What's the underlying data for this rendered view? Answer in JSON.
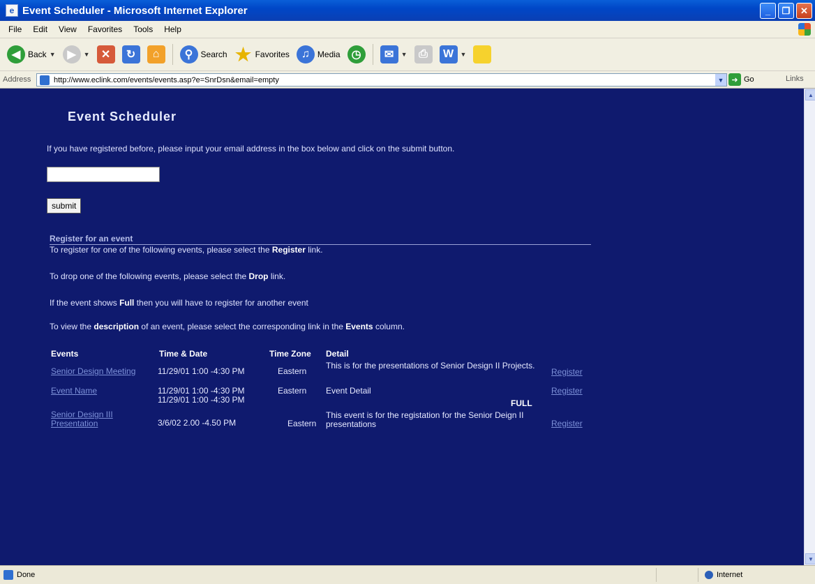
{
  "window": {
    "title": "Event Scheduler - Microsoft Internet Explorer"
  },
  "menu": [
    "File",
    "Edit",
    "View",
    "Favorites",
    "Tools",
    "Help"
  ],
  "toolbar": {
    "back": "Back",
    "search": "Search",
    "favorites": "Favorites",
    "media": "Media"
  },
  "address": {
    "label": "Address",
    "url": "http://www.eclink.com/events/events.asp?e=SnrDsn&email=empty",
    "go": "Go",
    "links": "Links"
  },
  "page": {
    "title": "Event Scheduler",
    "intro": "If you have registered before, please input your email address in the box below and click on the submit button.",
    "email_value": "",
    "submit_label": "submit",
    "section_heading": "Register for an event",
    "instr_register_pre": "To register for one of the following events, please select the ",
    "instr_register_bold": "Register",
    "instr_register_post": " link.",
    "instr_drop_pre": "To drop one of the following events, please select the ",
    "instr_drop_bold": "Drop",
    "instr_drop_post": " link.",
    "instr_full_pre": "If the event shows ",
    "instr_full_bold": "Full",
    "instr_full_post": " then you will have to register for another event",
    "instr_desc_pre": "To view the ",
    "instr_desc_bold": "description",
    "instr_desc_mid": " of an event, please select the corresponding link in the ",
    "instr_desc_bold2": "Events",
    "instr_desc_post": " column."
  },
  "table": {
    "headers": {
      "events": "Events",
      "time": "Time & Date",
      "zone": "Time Zone",
      "detail": "Detail"
    },
    "rows": [
      {
        "event": "Senior Design Meeting",
        "time": "11/29/01  1:00 -4:30 PM",
        "zone": "Eastern",
        "detail": "This is for the presentations of Senior Design II Projects.",
        "action": "Register"
      },
      {
        "event": "Event Name",
        "time": "11/29/01  1:00 -4:30 PM",
        "zone": "Eastern",
        "detail": "Event Detail",
        "action": "Register"
      },
      {
        "event": "",
        "time": "11/29/01  1:00 -4:30 PM",
        "zone": "",
        "detail": "",
        "action": "FULL"
      },
      {
        "event": "Senior Design III Presentation",
        "time": "3/6/02  2.00 -4.50 PM",
        "zone": "Eastern",
        "detail": "This event is for the registation for the Senior Deign II presentations",
        "action": "Register"
      }
    ]
  },
  "status": {
    "text": "Done",
    "zone": "Internet"
  }
}
